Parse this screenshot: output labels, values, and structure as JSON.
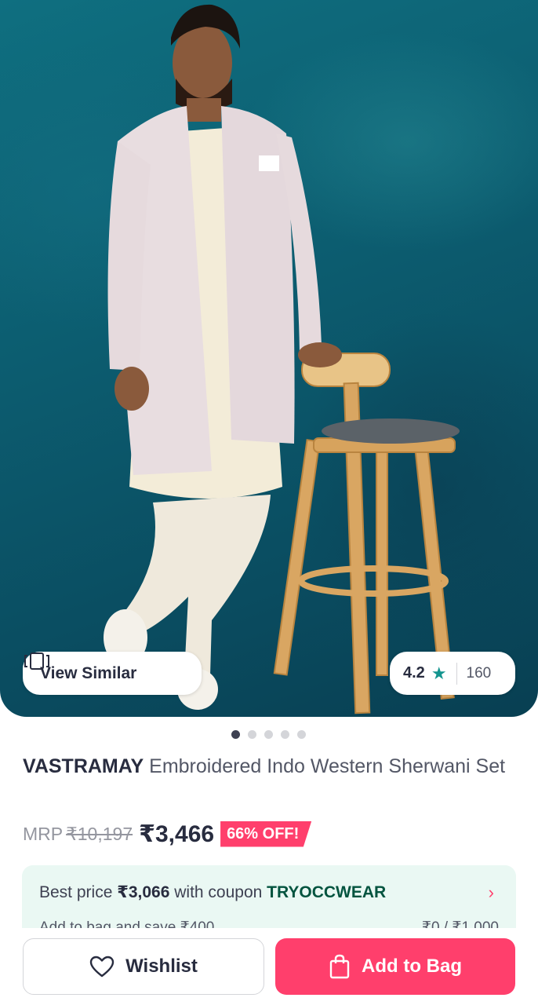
{
  "hero": {
    "view_similar_label": "View Similar",
    "rating_value": "4.2",
    "rating_star": "★",
    "rating_count": "160",
    "active_image": 1,
    "image_count": 5
  },
  "product": {
    "brand": "VASTRAMAY",
    "name": "Embroidered Indo Western Sherwani Set",
    "mrp_label": "MRP",
    "mrp": "₹10,197",
    "price": "₹3,466",
    "discount": "66% OFF!"
  },
  "coupon": {
    "prefix": "Best price",
    "best_price": "₹3,066",
    "middle": "with coupon",
    "code": "TRYOCCWEAR",
    "chevron": "›",
    "line2_left": "Add to bag and save ₹400",
    "line2_right": "₹0 / ₹1,000"
  },
  "actions": {
    "wishlist_label": "Wishlist",
    "add_to_bag_label": "Add to Bag"
  },
  "colors": {
    "accent": "#ff3f6c",
    "rating_star": "#14958f",
    "coupon_bg": "#eaf8f3",
    "coupon_code": "#03543f"
  },
  "icons": {
    "view_similar": "view-similar-icon",
    "star": "star-icon",
    "wishlist": "heart-icon",
    "bag": "shopping-bag-icon",
    "chevron": "chevron-right-icon"
  }
}
